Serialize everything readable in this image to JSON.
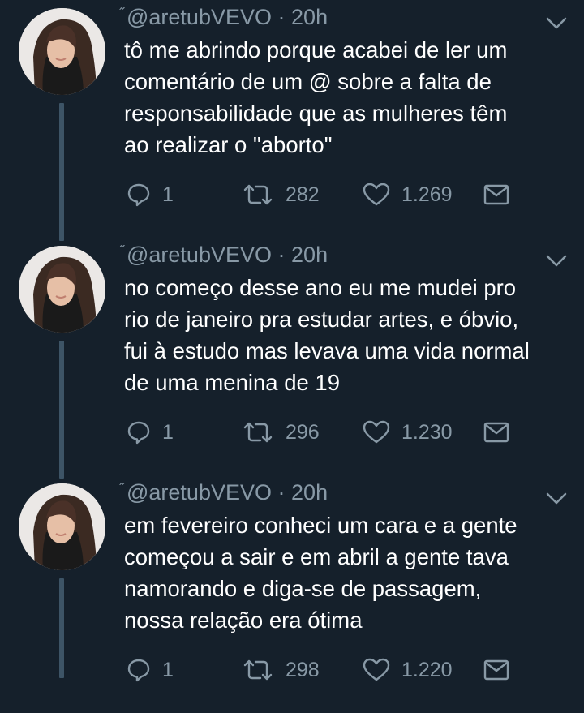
{
  "tweets": [
    {
      "handle": "@aretubVEVO",
      "time": "20h",
      "lines": [
        "tô me abrindo porque acabei de ler um",
        "comentário de um @ sobre a falta de",
        "responsabilidade que as mulheres têm",
        "ao realizar o \"aborto\""
      ],
      "replies": "1",
      "retweets": "282",
      "likes": "1.269"
    },
    {
      "handle": "@aretubVEVO",
      "time": "20h",
      "lines": [
        "no começo desse ano eu me mudei pro",
        "rio de janeiro pra estudar artes, e óbvio,",
        "fui à estudo mas levava uma vida normal",
        "de uma menina de 19"
      ],
      "replies": "1",
      "retweets": "296",
      "likes": "1.230"
    },
    {
      "handle": "@aretubVEVO",
      "time": "20h",
      "lines": [
        "em fevereiro conheci um cara e a gente",
        "começou a sair e em abril a gente tava",
        "namorando e diga-se de passagem,",
        "nossa relação era ótima"
      ],
      "replies": "1",
      "retweets": "298",
      "likes": "1.220"
    }
  ],
  "header_separator": "·",
  "colors": {
    "background": "#15202b",
    "secondary_text": "#8899a6",
    "primary_text": "#ffffff",
    "thread_line": "#3d5466"
  },
  "icons": [
    "reply-icon",
    "retweet-icon",
    "like-icon",
    "message-icon",
    "chevron-down-icon"
  ]
}
